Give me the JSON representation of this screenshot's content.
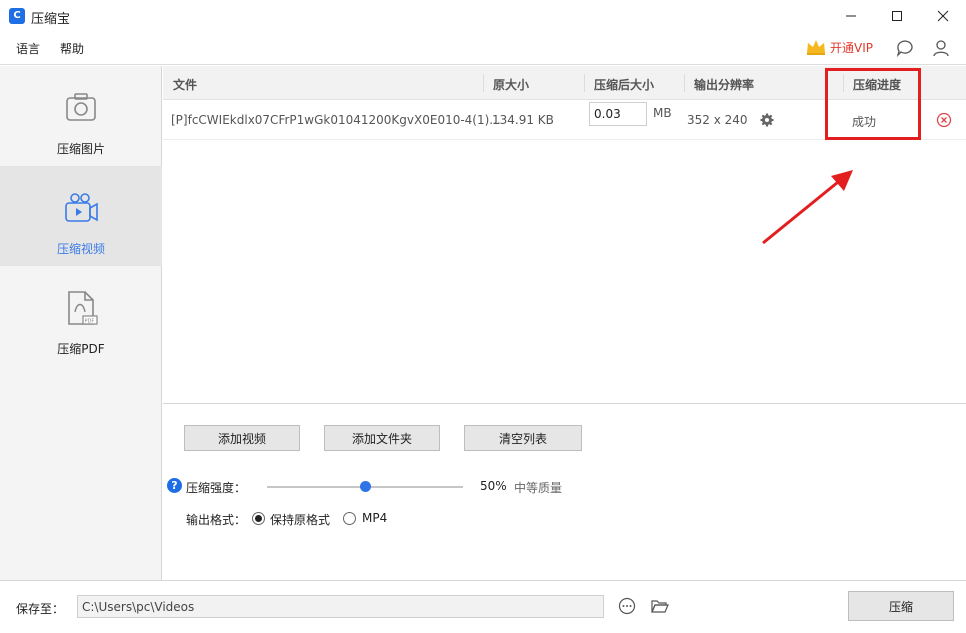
{
  "window": {
    "title": "压缩宝",
    "icon_letter": "C"
  },
  "menu": {
    "language": "语言",
    "help": "帮助",
    "vip_label": "开通VIP"
  },
  "sidebar": {
    "items": [
      {
        "label": "压缩图片",
        "icon": "camera-icon",
        "active": false
      },
      {
        "label": "压缩视频",
        "icon": "video-camera-icon",
        "active": true
      },
      {
        "label": "压缩PDF",
        "icon": "pdf-file-icon",
        "active": false
      }
    ]
  },
  "table": {
    "headers": {
      "file": "文件",
      "original_size": "原大小",
      "compressed_size": "压缩后大小",
      "output_resolution": "输出分辨率",
      "progress": "压缩进度"
    },
    "rows": [
      {
        "file": "[P]fcCWIEkdlx07CFrP1wGk01041200KgvX0E010-4(1)...",
        "original_size": "134.91 KB",
        "target_value": "0.03",
        "target_unit": "MB",
        "resolution": "352 x 240",
        "status": "成功"
      }
    ]
  },
  "actions": {
    "add_video": "添加视频",
    "add_folder": "添加文件夹",
    "clear_list": "清空列表",
    "strength_label": "压缩强度：",
    "strength_percent": "50%",
    "strength_value": 0.5,
    "quality_text": "中等质量",
    "format_label": "输出格式：",
    "format_keep": "保持原格式",
    "format_mp4": "MP4"
  },
  "footer": {
    "save_label": "保存至：",
    "path": "C:\\Users\\pc\\Videos",
    "compress_button": "压缩"
  },
  "colors": {
    "accent": "#2f74e6",
    "vip": "#e03a2c",
    "highlight": "#e41e1e",
    "error": "#e0474c"
  }
}
